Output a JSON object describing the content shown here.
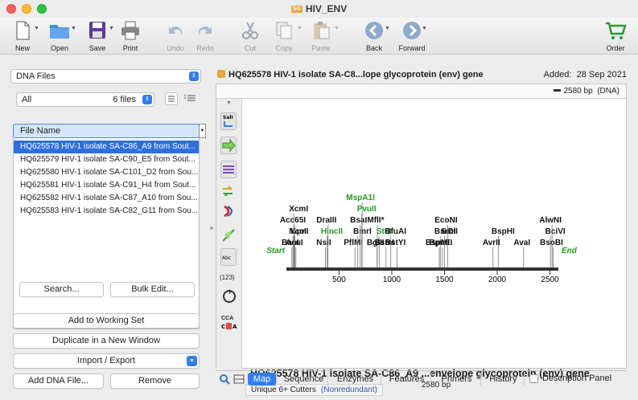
{
  "window": {
    "title": "HIV_ENV",
    "badge": "SG"
  },
  "toolbar": {
    "new": "New",
    "open": "Open",
    "save": "Save",
    "print": "Print",
    "undo": "Undo",
    "redo": "Redo",
    "cut": "Cut",
    "copy": "Copy",
    "paste": "Paste",
    "back": "Back",
    "forward": "Forward",
    "order": "Order"
  },
  "left": {
    "collection": "DNA Files",
    "filter": "All",
    "file_count": "6 files",
    "column_header": "File Name",
    "files": [
      "HQ625578 HIV-1 isolate SA-C86_A9 from Sout...",
      "HQ625579 HIV-1 isolate SA-C90_E5 from Sout...",
      "HQ625580 HIV-1 isolate SA-C101_D2 from Sou...",
      "HQ625581 HIV-1 isolate SA-C91_H4 from Sout...",
      "HQ625582 HIV-1 isolate SA-C87_A10 from Sou...",
      "HQ625583 HIV-1 isolate SA-C82_G11 from Sou..."
    ],
    "search": "Search...",
    "bulk_edit": "Bulk Edit...",
    "add_working_set": "Add to Working Set",
    "duplicate_window": "Duplicate in a New Window",
    "import_export": "Import / Export",
    "add_dna": "Add DNA File...",
    "remove": "Remove"
  },
  "doc": {
    "header": "HQ625578 HIV-1 isolate SA-C8...lope glycoprotein (env) gene",
    "added_label": "Added:",
    "added_date": "28 Sep 2021",
    "length_info": "2580 bp",
    "topology": "(DNA)",
    "map_title": "HQ625578 HIV-1 isolate SA-C86_A9 ...envelope glycoprotein (env) gene",
    "map_length": "2580 bp",
    "cutters_label": "Unique 6+ Cutters",
    "cutters_mode": "(Nonredundant)",
    "side_count": "(123)",
    "side_cca": "CCA",
    "tabs": [
      "Map",
      "Sequence",
      "Enzymes",
      "Features",
      "Primers",
      "History"
    ],
    "description_panel": "Description Panel"
  },
  "colors": {
    "accent": "#2f7ef6",
    "green_label": "#1e9b1e",
    "selection": "#2f6fdd"
  },
  "chart_data": {
    "type": "linear-map",
    "length_bp": 2580,
    "ticks": [
      500,
      1000,
      1500,
      2000,
      2500
    ],
    "start_label": "Start",
    "end_label": "End",
    "enzymes": [
      {
        "name": "BanI",
        "pos": 52,
        "color": "black"
      },
      {
        "name": "AcuI",
        "pos": 90,
        "color": "black"
      },
      {
        "name": "KpnI",
        "pos": 80,
        "color": "black"
      },
      {
        "name": "Acc65I",
        "pos": 76,
        "color": "black"
      },
      {
        "name": "XcmI",
        "pos": 70,
        "color": "black"
      },
      {
        "name": "NcoI",
        "pos": 62,
        "color": "black"
      },
      {
        "name": "NsiI",
        "pos": 370,
        "color": "black"
      },
      {
        "name": "HincII",
        "pos": 385,
        "color": "green"
      },
      {
        "name": "DraIII",
        "pos": 395,
        "color": "black"
      },
      {
        "name": "PflMI",
        "pos": 650,
        "color": "black"
      },
      {
        "name": "BmrI",
        "pos": 675,
        "color": "black"
      },
      {
        "name": "BsaI",
        "pos": 700,
        "color": "black"
      },
      {
        "name": "PvuII",
        "pos": 715,
        "color": "green"
      },
      {
        "name": "MspA1I",
        "pos": 718,
        "color": "green"
      },
      {
        "name": "BglII",
        "pos": 860,
        "color": "black"
      },
      {
        "name": "StuI",
        "pos": 880,
        "color": "green"
      },
      {
        "name": "MflI*",
        "pos": 862,
        "color": "black"
      },
      {
        "name": "BsmI",
        "pos": 945,
        "color": "black"
      },
      {
        "name": "BfuAI",
        "pos": 990,
        "color": "black"
      },
      {
        "name": "BstYI",
        "pos": 1050,
        "color": "black"
      },
      {
        "name": "BspMI",
        "pos": 1450,
        "color": "black"
      },
      {
        "name": "BsrDI",
        "pos": 1460,
        "color": "black"
      },
      {
        "name": "BpuEI",
        "pos": 1480,
        "color": "black"
      },
      {
        "name": "SmlI",
        "pos": 1500,
        "color": "black"
      },
      {
        "name": "EcoNI",
        "pos": 1530,
        "color": "black"
      },
      {
        "name": "AvrII",
        "pos": 1960,
        "color": "black"
      },
      {
        "name": "BspHI",
        "pos": 2010,
        "color": "black"
      },
      {
        "name": "AvaI",
        "pos": 2250,
        "color": "black"
      },
      {
        "name": "BsoBI",
        "pos": 2530,
        "color": "black"
      },
      {
        "name": "BciVI",
        "pos": 2505,
        "color": "black"
      },
      {
        "name": "AlwNI",
        "pos": 2520,
        "color": "black"
      }
    ]
  }
}
